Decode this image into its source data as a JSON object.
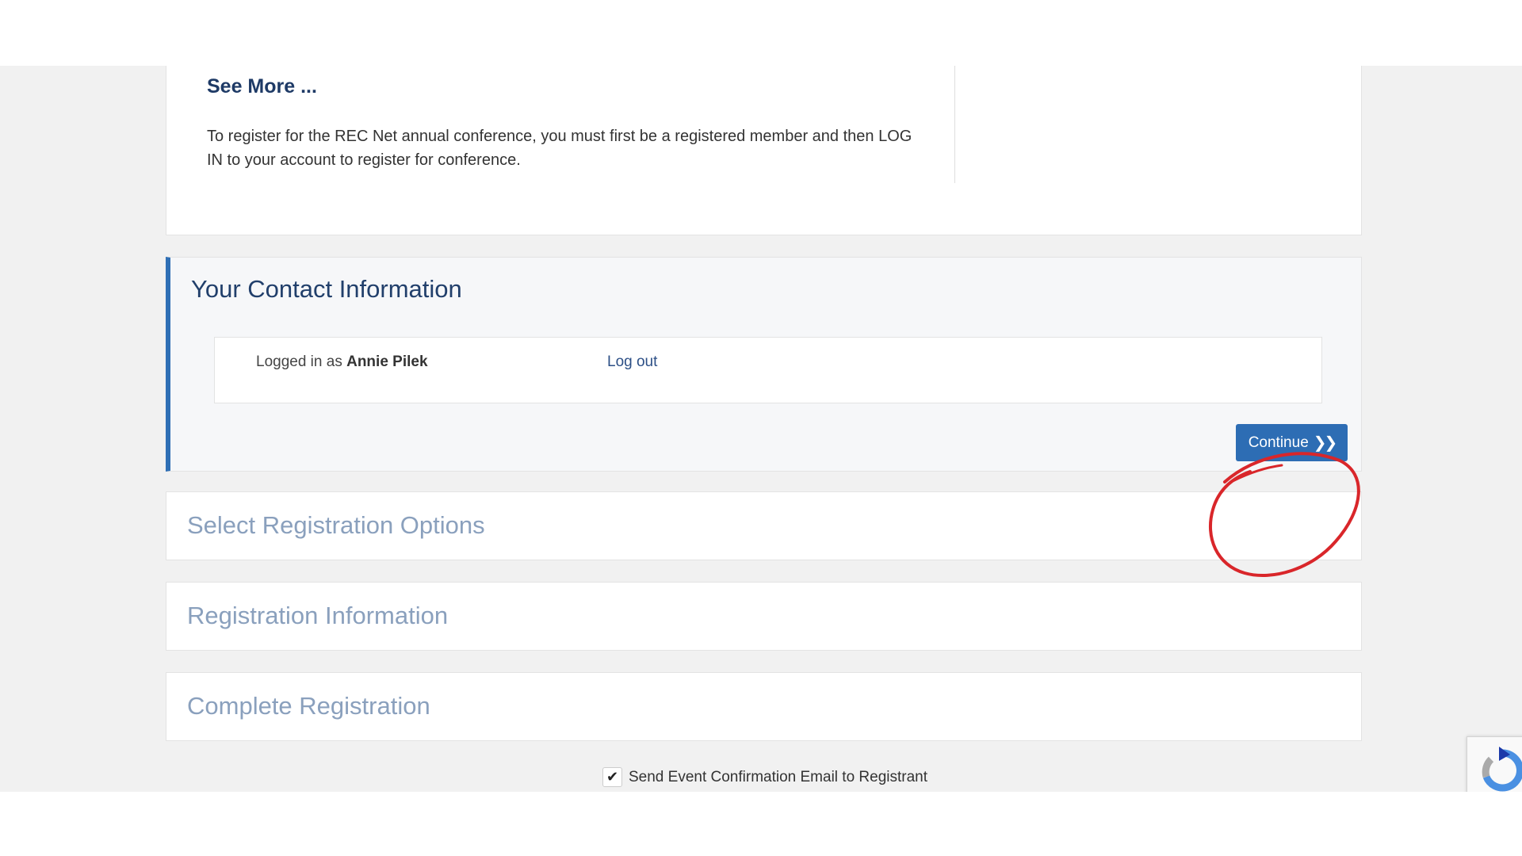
{
  "intro_card": {
    "see_more": "See More ...",
    "text": "To register for the REC Net annual conference, you must first be a registered member and then LOG IN to your account to register for conference."
  },
  "contact": {
    "title": "Your Contact Information",
    "logged_in_prefix": "Logged in as",
    "user_name": "Annie Pilek",
    "logout_label": "Log out",
    "continue_label": "Continue",
    "continue_icon": "double-chevron-right-icon"
  },
  "sections": [
    {
      "title": "Select Registration Options"
    },
    {
      "title": "Registration Information"
    },
    {
      "title": "Complete Registration"
    }
  ],
  "confirmation": {
    "checked": true,
    "label": "Send Event Confirmation Email to Registrant"
  },
  "colors": {
    "accent": "#2d6db4",
    "heading": "#213f6b",
    "inactive_heading": "#8aa0bd",
    "annotation": "#d9262a"
  }
}
